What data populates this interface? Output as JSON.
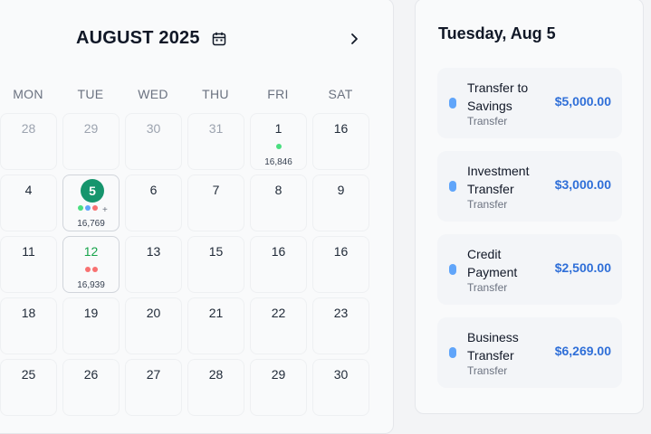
{
  "calendar": {
    "month_title": "AUGUST 2025",
    "weekdays": [
      "MON",
      "TUE",
      "WED",
      "THU",
      "FRI",
      "SAT"
    ],
    "weeks": [
      [
        {
          "day": "28",
          "muted": true
        },
        {
          "day": "29",
          "muted": true
        },
        {
          "day": "30",
          "muted": true
        },
        {
          "day": "31",
          "muted": true
        },
        {
          "day": "1",
          "dots": [
            "#4ade80"
          ],
          "amount": "16,846"
        },
        {
          "day": "16"
        }
      ],
      [
        {
          "day": "4"
        },
        {
          "day": "5",
          "today": true,
          "dots": [
            "#4ade80",
            "#60a5fa",
            "#f87171"
          ],
          "more": "+",
          "amount": "16,769",
          "selected": true
        },
        {
          "day": "6"
        },
        {
          "day": "7"
        },
        {
          "day": "8"
        },
        {
          "day": "9"
        }
      ],
      [
        {
          "day": "11"
        },
        {
          "day": "12",
          "highlight": true,
          "dots": [
            "#f87171",
            "#f87171"
          ],
          "amount": "16,939",
          "selected": true
        },
        {
          "day": "13"
        },
        {
          "day": "15"
        },
        {
          "day": "16"
        },
        {
          "day": "16"
        }
      ],
      [
        {
          "day": "18"
        },
        {
          "day": "19"
        },
        {
          "day": "20"
        },
        {
          "day": "21"
        },
        {
          "day": "22"
        },
        {
          "day": "23"
        }
      ],
      [
        {
          "day": "25"
        },
        {
          "day": "26"
        },
        {
          "day": "27"
        },
        {
          "day": "28"
        },
        {
          "day": "29"
        },
        {
          "day": "30"
        }
      ]
    ]
  },
  "detail": {
    "title": "Tuesday, Aug 5",
    "transactions": [
      {
        "name": "Transfer to Savings",
        "type": "Transfer",
        "amount": "$5,000.00",
        "color": "#60a5fa"
      },
      {
        "name": "Investment Transfer",
        "type": "Transfer",
        "amount": "$3,000.00",
        "color": "#60a5fa"
      },
      {
        "name": "Credit Payment",
        "type": "Transfer",
        "amount": "$2,500.00",
        "color": "#60a5fa"
      },
      {
        "name": "Business Transfer",
        "type": "Transfer",
        "amount": "$6,269.00",
        "color": "#60a5fa"
      }
    ]
  },
  "icons": {
    "calendar": "calendar-icon",
    "next": "chevron-right-icon"
  }
}
